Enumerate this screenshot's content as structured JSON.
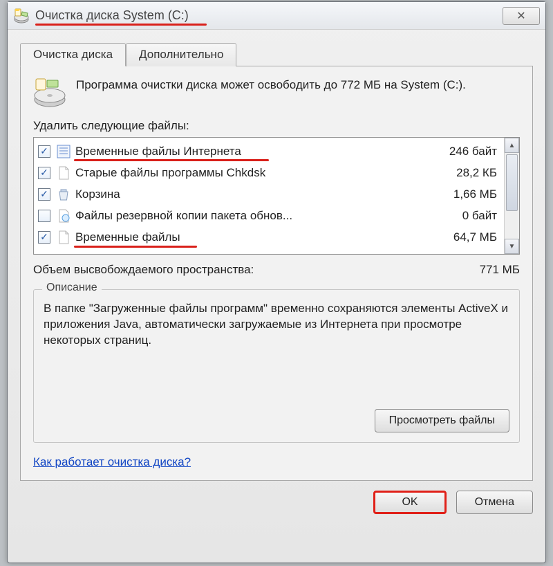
{
  "window": {
    "title": "Очистка диска System (C:)"
  },
  "tabs": {
    "cleanup": "Очистка диска",
    "advanced": "Дополнительно"
  },
  "summary": "Программа очистки диска может освободить до 772 МБ на System (C:).",
  "list_label": "Удалить следующие файлы:",
  "files": [
    {
      "checked": true,
      "name": "Временные файлы Интернета",
      "size": "246 байт"
    },
    {
      "checked": true,
      "name": "Старые файлы программы Chkdsk",
      "size": "28,2 КБ"
    },
    {
      "checked": true,
      "name": "Корзина",
      "size": "1,66 МБ"
    },
    {
      "checked": false,
      "name": "Файлы резервной копии пакета обнов...",
      "size": "0 байт"
    },
    {
      "checked": true,
      "name": "Временные файлы",
      "size": "64,7 МБ"
    }
  ],
  "total": {
    "label": "Объем высвобождаемого пространства:",
    "value": "771 МБ"
  },
  "description": {
    "title": "Описание",
    "text": "В папке \"Загруженные файлы программ\" временно сохраняются элементы ActiveX и приложения Java, автоматически загружаемые из Интернета при просмотре некоторых страниц."
  },
  "buttons": {
    "view_files": "Просмотреть файлы",
    "ok": "OK",
    "cancel": "Отмена"
  },
  "help_link": "Как работает очистка диска?"
}
